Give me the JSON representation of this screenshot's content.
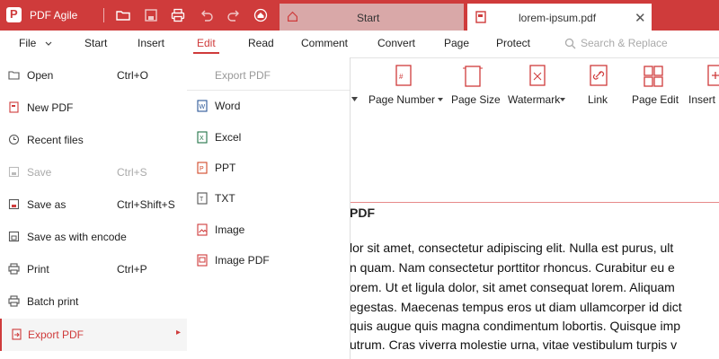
{
  "app": {
    "name": "PDF Agile"
  },
  "tabs": [
    {
      "label": "Start"
    },
    {
      "label": "lorem-ipsum.pdf"
    }
  ],
  "menubar": {
    "items": [
      "File",
      "Start",
      "Insert",
      "Edit",
      "Read",
      "Comment",
      "Convert",
      "Page",
      "Protect"
    ],
    "active": "Edit",
    "search_placeholder": "Search & Replace"
  },
  "toolbar": {
    "items": [
      {
        "label": "Page Number",
        "dropdown": true
      },
      {
        "label": "Page Size"
      },
      {
        "label": "Watermark",
        "dropdown": true
      },
      {
        "label": "Link"
      },
      {
        "label": "Page Edit"
      },
      {
        "label": "Insert P"
      }
    ]
  },
  "file_menu": {
    "items": [
      {
        "label": "Open",
        "shortcut": "Ctrl+O",
        "icon": "folder-icon"
      },
      {
        "label": "New PDF",
        "shortcut": "",
        "icon": "new-pdf-icon"
      },
      {
        "label": "Recent files",
        "shortcut": "",
        "icon": "clock-icon"
      },
      {
        "label": "Save",
        "shortcut": "Ctrl+S",
        "icon": "save-icon",
        "disabled": true
      },
      {
        "label": "Save as",
        "shortcut": "Ctrl+Shift+S",
        "icon": "save-as-icon"
      },
      {
        "label": "Save as with encode",
        "shortcut": "",
        "icon": "save-encode-icon"
      },
      {
        "label": "Print",
        "shortcut": "Ctrl+P",
        "icon": "print-icon"
      },
      {
        "label": "Batch print",
        "shortcut": "",
        "icon": "batch-print-icon"
      },
      {
        "label": "Export PDF",
        "shortcut": "",
        "icon": "export-icon",
        "active": true
      }
    ]
  },
  "export_submenu": {
    "header": "Export PDF",
    "items": [
      {
        "label": "Word",
        "icon": "word-icon",
        "color": "#2b5797"
      },
      {
        "label": "Excel",
        "icon": "excel-icon",
        "color": "#217346"
      },
      {
        "label": "PPT",
        "icon": "ppt-icon",
        "color": "#d24726"
      },
      {
        "label": "TXT",
        "icon": "txt-icon",
        "color": "#555555"
      },
      {
        "label": "Image",
        "icon": "image-icon",
        "color": "#cf3b3b"
      },
      {
        "label": "Image PDF",
        "icon": "image-pdf-icon",
        "color": "#cf3b3b"
      }
    ]
  },
  "document": {
    "heading": "PDF",
    "lines": [
      "lor sit amet, consectetur adipiscing elit. Nulla est purus, ult",
      "n quam. Nam consectetur porttitor rhoncus. Curabitur eu e",
      "orem. Ut et ligula dolor, sit amet consequat lorem. Aliquam",
      "egestas. Maecenas tempus eros ut diam ullamcorper id dict",
      "quis augue quis magna condimentum lobortis. Quisque imp",
      "utrum. Cras viverra molestie urna, vitae vestibulum turpis v"
    ]
  },
  "colors": {
    "accent": "#cf3b3b",
    "inactive_tab": "#d9a8a8"
  }
}
